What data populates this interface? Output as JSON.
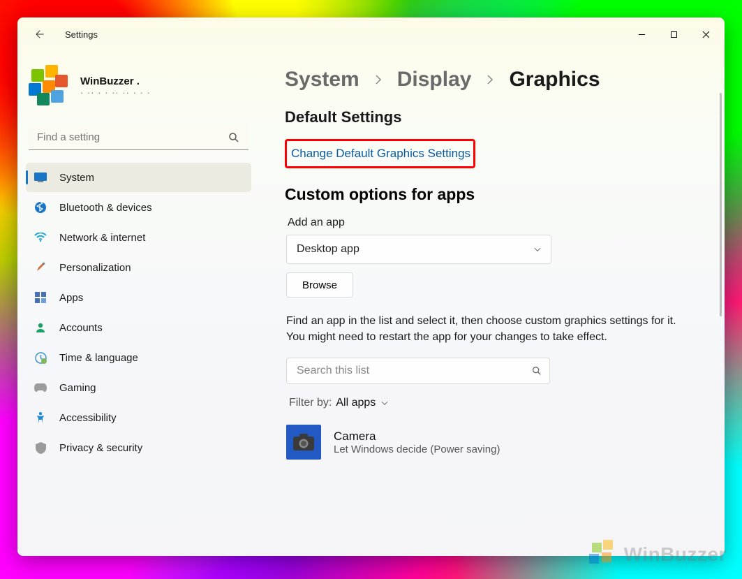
{
  "app_title": "Settings",
  "profile": {
    "name": "WinBuzzer .",
    "sub": "· ·· · · ·· ·· · · ·"
  },
  "search_placeholder": "Find a setting",
  "nav": [
    {
      "key": "system",
      "label": "System"
    },
    {
      "key": "bluetooth",
      "label": "Bluetooth & devices"
    },
    {
      "key": "network",
      "label": "Network & internet"
    },
    {
      "key": "personalization",
      "label": "Personalization"
    },
    {
      "key": "apps",
      "label": "Apps"
    },
    {
      "key": "accounts",
      "label": "Accounts"
    },
    {
      "key": "time",
      "label": "Time & language"
    },
    {
      "key": "gaming",
      "label": "Gaming"
    },
    {
      "key": "accessibility",
      "label": "Accessibility"
    },
    {
      "key": "privacy",
      "label": "Privacy & security"
    }
  ],
  "breadcrumbs": {
    "a": "System",
    "b": "Display",
    "c": "Graphics"
  },
  "default_settings_heading": "Default Settings",
  "change_link": "Change Default Graphics Settings",
  "custom_heading": "Custom options for apps",
  "add_label": "Add an app",
  "app_type_selected": "Desktop app",
  "browse_label": "Browse",
  "help_text": "Find an app in the list and select it, then choose custom graphics settings for it. You might need to restart the app for your changes to take effect.",
  "list_search_placeholder": "Search this list",
  "filter_label": "Filter by:",
  "filter_value": "All apps",
  "apps": [
    {
      "name": "Camera",
      "sub": "Let Windows decide (Power saving)"
    }
  ],
  "watermark": "WinBuzzer"
}
